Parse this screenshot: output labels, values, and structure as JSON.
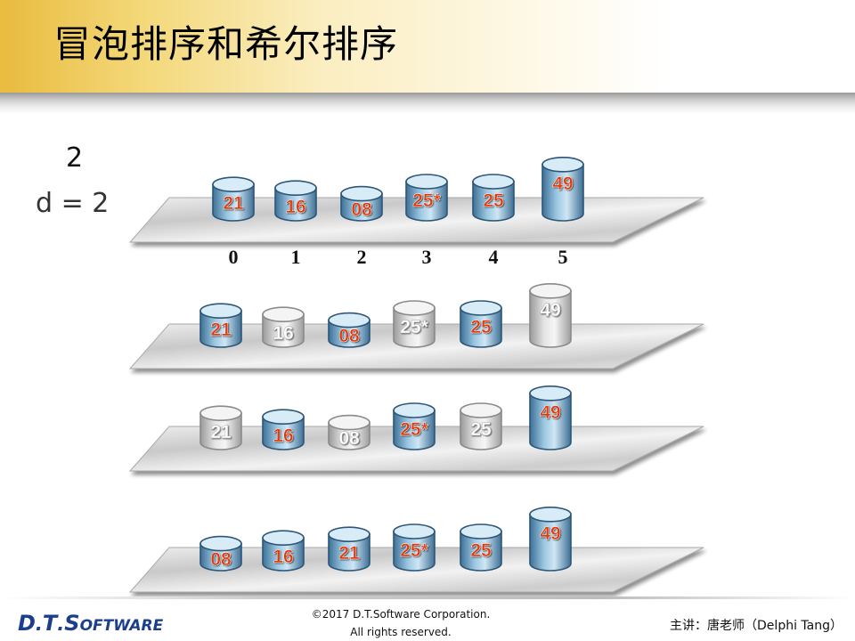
{
  "title": "冒泡排序和希尔排序",
  "pass_label": "2",
  "gap_label": "d = 2",
  "index_labels": [
    "0",
    "1",
    "2",
    "3",
    "4",
    "5"
  ],
  "rows": [
    {
      "cells": [
        {
          "label": "21",
          "value": 21,
          "active": true
        },
        {
          "label": "16",
          "value": 16,
          "active": true
        },
        {
          "label": "08",
          "value": 8,
          "active": true
        },
        {
          "label": "25*",
          "value": 25,
          "active": true
        },
        {
          "label": "25",
          "value": 25,
          "active": true
        },
        {
          "label": "49",
          "value": 49,
          "active": true
        }
      ]
    },
    {
      "cells": [
        {
          "label": "21",
          "value": 21,
          "active": true
        },
        {
          "label": "16",
          "value": 16,
          "active": false
        },
        {
          "label": "08",
          "value": 8,
          "active": true
        },
        {
          "label": "25*",
          "value": 25,
          "active": false
        },
        {
          "label": "25",
          "value": 25,
          "active": true
        },
        {
          "label": "49",
          "value": 49,
          "active": false
        }
      ]
    },
    {
      "cells": [
        {
          "label": "21",
          "value": 21,
          "active": false
        },
        {
          "label": "16",
          "value": 16,
          "active": true
        },
        {
          "label": "08",
          "value": 8,
          "active": false
        },
        {
          "label": "25*",
          "value": 25,
          "active": true
        },
        {
          "label": "25",
          "value": 25,
          "active": false
        },
        {
          "label": "49",
          "value": 49,
          "active": true
        }
      ]
    },
    {
      "cells": [
        {
          "label": "08",
          "value": 8,
          "active": true
        },
        {
          "label": "16",
          "value": 16,
          "active": true
        },
        {
          "label": "21",
          "value": 21,
          "active": true
        },
        {
          "label": "25*",
          "value": 25,
          "active": true
        },
        {
          "label": "25",
          "value": 25,
          "active": true
        },
        {
          "label": "49",
          "value": 49,
          "active": true
        }
      ]
    }
  ],
  "footer": {
    "logo_d": "D",
    "logo_t": "T",
    "logo_s": "S",
    "logo_rest": "OFTWARE",
    "copyright_line1": "©2017 D.T.Software Corporation.",
    "copyright_line2": "All rights reserved.",
    "presenter": "主讲：唐老师（Delphi Tang）"
  },
  "colors": {
    "active_top": "#d8ecf7",
    "active_mid": "#7fb3d5",
    "active_dark": "#3e7096",
    "inactive_mid": "#d0d0d0",
    "number_active": "#e03a10",
    "number_inactive": "#ffffff",
    "header_gold": "#e9bb3f",
    "logo_blue": "#1b3f8b"
  }
}
